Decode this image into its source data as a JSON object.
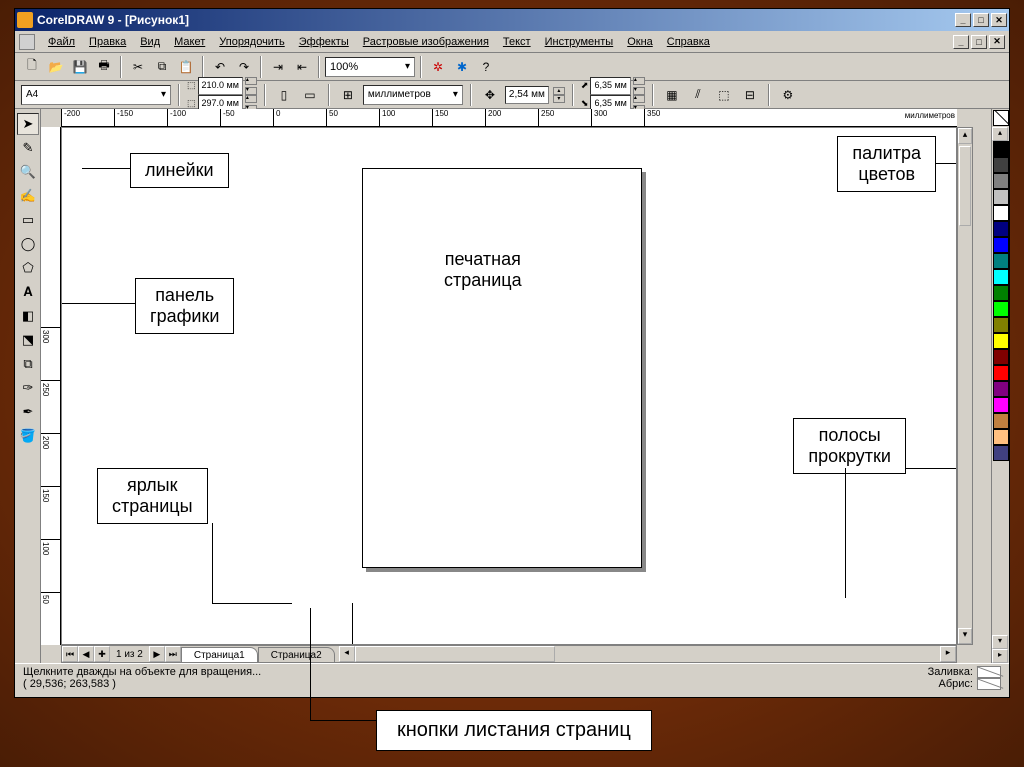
{
  "titlebar": {
    "text": "CorelDRAW 9 - [Рисунок1]"
  },
  "menu": {
    "items": [
      "Файл",
      "Правка",
      "Вид",
      "Макет",
      "Упорядочить",
      "Эффекты",
      "Растровые изображения",
      "Текст",
      "Инструменты",
      "Окна",
      "Справка"
    ]
  },
  "toolbar": {
    "zoom": "100%",
    "icons": [
      "new",
      "open",
      "save",
      "print",
      "cut",
      "copy",
      "paste",
      "undo",
      "redo",
      "import",
      "export"
    ]
  },
  "propbar": {
    "pagesize": "A4",
    "width": "210.0 мм",
    "height": "297.0 мм",
    "units": "миллиметров",
    "nudge": "2,54 мм",
    "dup_x": "6,35 мм",
    "dup_y": "6,35 мм"
  },
  "ruler": {
    "h": [
      "-200",
      "-150",
      "-100",
      "-50",
      "0",
      "50",
      "100",
      "150",
      "200",
      "250",
      "300",
      "350"
    ],
    "v": [
      "50",
      "100",
      "150",
      "200",
      "250",
      "300"
    ],
    "units_label": "миллиметров"
  },
  "callouts": {
    "rulers": "линейки",
    "toolbox": "панель\nграфики",
    "page": "печатная\nстраница",
    "palette": "палитра\nцветов",
    "scroll": "полосы\nпрокрутки",
    "pagetab": "ярлык\nстраницы",
    "pagenav": "кнопки листания страниц"
  },
  "pagenav": {
    "info": "1 из 2",
    "tabs": [
      "Страница1",
      "Страница2"
    ]
  },
  "status": {
    "hint": "Щелкните дважды на объекте для вращения...",
    "coords": "( 29,536; 263,583 )",
    "fill_label": "Заливка:",
    "outline_label": "Абрис:"
  },
  "palette_colors": [
    "#000000",
    "#404040",
    "#808080",
    "#c0c0c0",
    "#ffffff",
    "#000080",
    "#0000ff",
    "#008080",
    "#00ffff",
    "#008000",
    "#00ff00",
    "#808000",
    "#ffff00",
    "#800000",
    "#ff0000",
    "#800080",
    "#ff00ff",
    "#c08040",
    "#ffc080",
    "#404080"
  ]
}
